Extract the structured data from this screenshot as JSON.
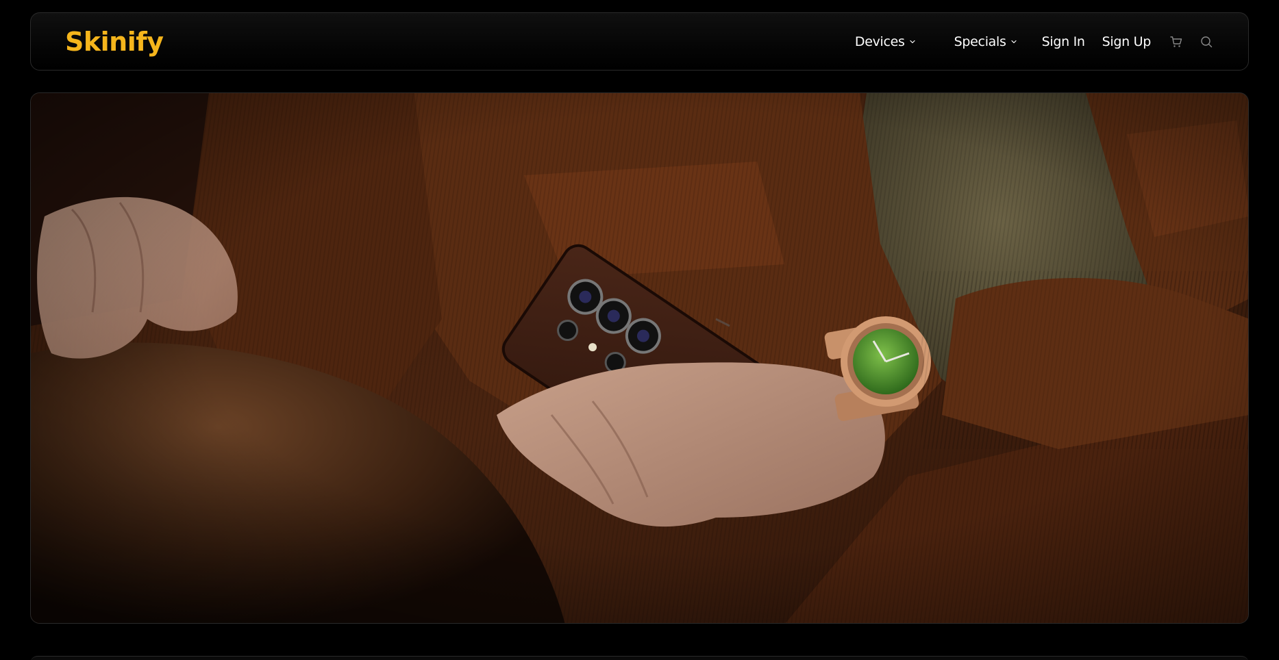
{
  "brand": {
    "name": "Skinify",
    "accent_color": "#f5b51c"
  },
  "nav": {
    "items": [
      {
        "label": "Devices",
        "has_dropdown": true,
        "icon": "chevron-down-icon"
      },
      {
        "label": "Specials",
        "has_dropdown": true,
        "icon": "chevron-down-icon"
      },
      {
        "label": "Sign In",
        "has_dropdown": false
      },
      {
        "label": "Sign Up",
        "has_dropdown": false
      }
    ],
    "icons": [
      "cart-icon",
      "search-icon"
    ]
  },
  "hero": {
    "image_subject": "hand holding phone with brown leather skin, gold watch with green dial, brown corduroy jacket"
  }
}
